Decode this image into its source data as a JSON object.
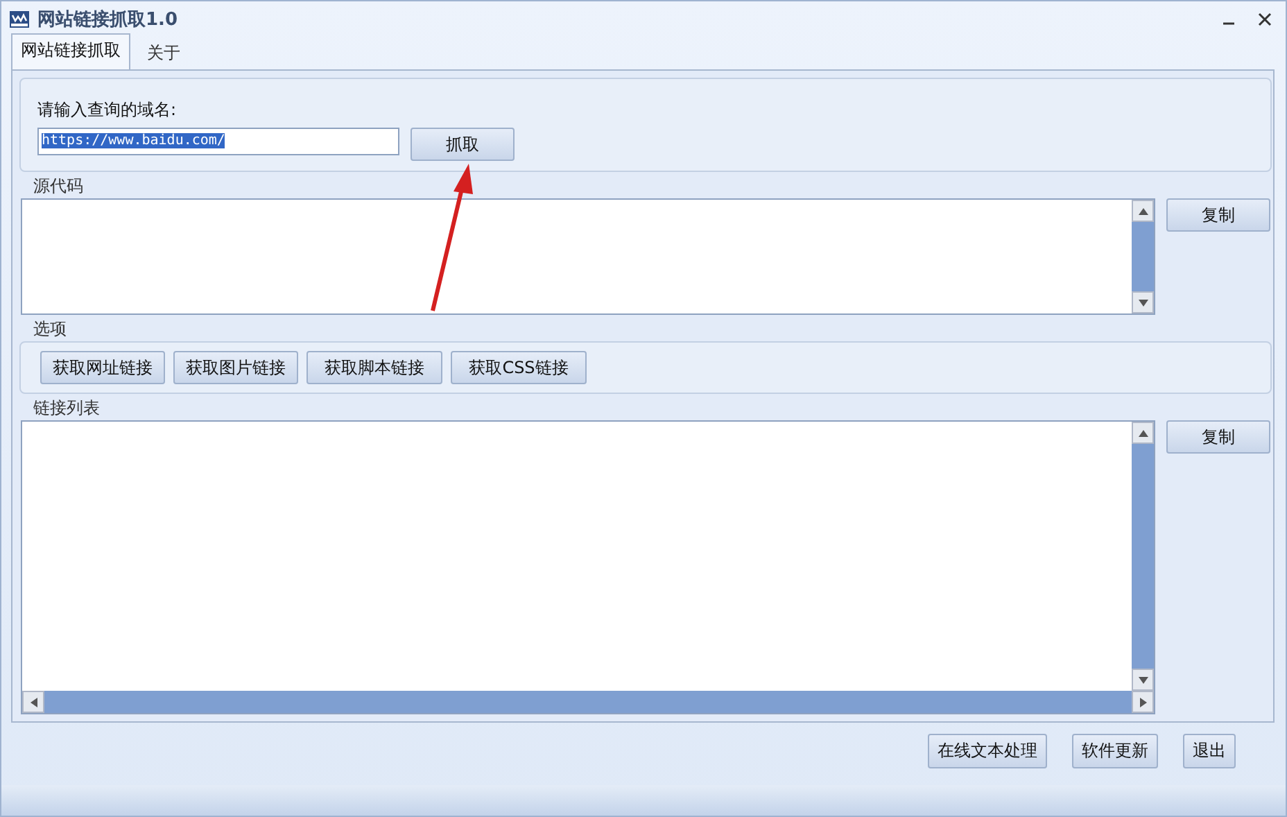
{
  "window": {
    "title": "网站链接抓取1.0"
  },
  "tabs": [
    {
      "label": "网站链接抓取",
      "selected": true
    },
    {
      "label": "关于",
      "selected": false
    }
  ],
  "domain": {
    "label": "请输入查询的域名:",
    "value": "https://www.baidu.com/",
    "text_selected": true,
    "button": "抓取"
  },
  "source": {
    "label": "源代码",
    "copy_button": "复制"
  },
  "options": {
    "label": "选项",
    "buttons": [
      "获取网址链接",
      "获取图片链接",
      "获取脚本链接",
      "获取CSS链接"
    ]
  },
  "links": {
    "label": "链接列表",
    "copy_button": "复制"
  },
  "footer_buttons": [
    "在线文本处理",
    "软件更新",
    "退出"
  ]
}
